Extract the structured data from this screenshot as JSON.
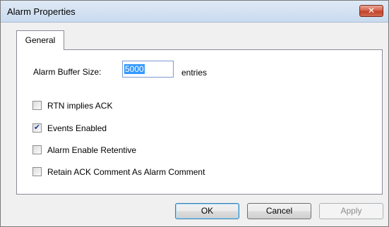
{
  "window": {
    "title": "Alarm Properties",
    "close_icon": "close-icon",
    "close_glyph": "✕",
    "close_color": "#c7432a"
  },
  "tabs": [
    {
      "label": "General",
      "active": true
    }
  ],
  "general": {
    "buffer_label": "Alarm Buffer Size:",
    "buffer_value": "5000",
    "buffer_unit": "entries",
    "checkboxes": [
      {
        "label": "RTN implies ACK",
        "checked": false
      },
      {
        "label": "Events Enabled",
        "checked": true
      },
      {
        "label": "Alarm Enable Retentive",
        "checked": false
      },
      {
        "label": "Retain ACK Comment As Alarm Comment",
        "checked": false
      }
    ]
  },
  "buttons": {
    "ok": "OK",
    "cancel": "Cancel",
    "apply": "Apply",
    "apply_enabled": false
  }
}
